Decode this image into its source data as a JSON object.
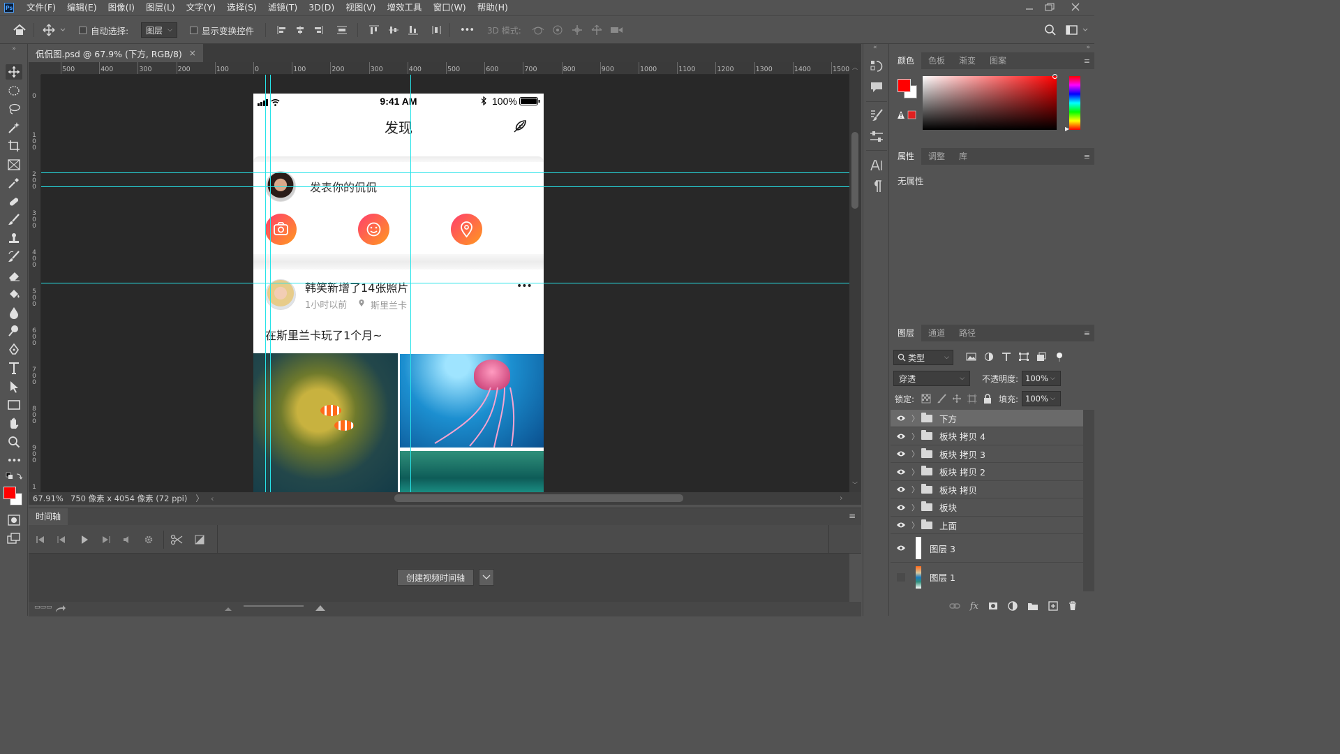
{
  "menubar": {
    "items": [
      "文件(F)",
      "编辑(E)",
      "图像(I)",
      "图层(L)",
      "文字(Y)",
      "选择(S)",
      "滤镜(T)",
      "3D(D)",
      "视图(V)",
      "增效工具",
      "窗口(W)",
      "帮助(H)"
    ]
  },
  "options": {
    "auto_select": "自动选择:",
    "layer_select": "图层",
    "show_transform": "显示变换控件",
    "more": "•••",
    "mode3d": "3D 模式:"
  },
  "document": {
    "tab_title": "侃侃图.psd @ 67.9% (下方, RGB/8)",
    "ruler_top": [
      "500",
      "400",
      "300",
      "200",
      "100",
      "0",
      "100",
      "200",
      "300",
      "400",
      "500",
      "600",
      "700",
      "800",
      "900",
      "1000",
      "1100",
      "1200",
      "1300",
      "1400",
      "1500"
    ],
    "ruler_left": [
      "0",
      "1\n0\n0",
      "2\n0\n0",
      "3\n0\n0",
      "4\n0\n0",
      "5\n0\n0",
      "6\n0\n0",
      "7\n0\n0",
      "8\n0\n0",
      "9\n0\n0",
      "1"
    ]
  },
  "status": {
    "zoom": "67.91%",
    "info": "750 像素 x 4054 像素 (72 ppi)",
    "arrow": "〉"
  },
  "artboard": {
    "time": "9:41 AM",
    "battery": "100%",
    "title": "发现",
    "compose_placeholder": "发表你的侃侃",
    "post_author_line": "韩笑新增了14张照片",
    "post_time": "1小时以前",
    "post_location": "斯里兰卡",
    "post_text": "在斯里兰卡玩了1个月~",
    "more_dots": "•••"
  },
  "timeline": {
    "title": "时间轴",
    "create_button": "创建视频时间轴"
  },
  "panels": {
    "color_tabs": [
      "颜色",
      "色板",
      "渐变",
      "图案"
    ],
    "props_tabs": [
      "属性",
      "调整",
      "库"
    ],
    "props_empty": "无属性",
    "layers_tabs": [
      "图层",
      "通道",
      "路径"
    ],
    "filter_type": "类型",
    "blend_mode": "穿透",
    "opacity_label": "不透明度:",
    "opacity_value": "100%",
    "lock_label": "锁定:",
    "fill_label": "填充:",
    "fill_value": "100%",
    "layers": [
      {
        "name": "下方",
        "kind": "group",
        "visible": true,
        "selected": true
      },
      {
        "name": "板块 拷贝 4",
        "kind": "group",
        "visible": true
      },
      {
        "name": "板块 拷贝 3",
        "kind": "group",
        "visible": true
      },
      {
        "name": "板块 拷贝 2",
        "kind": "group",
        "visible": true
      },
      {
        "name": "板块 拷贝",
        "kind": "group",
        "visible": true
      },
      {
        "name": "板块",
        "kind": "group",
        "visible": true
      },
      {
        "name": "上面",
        "kind": "group",
        "visible": true
      },
      {
        "name": "图层 3",
        "kind": "layer",
        "visible": true
      },
      {
        "name": "图层 1",
        "kind": "layer",
        "visible": false
      }
    ]
  },
  "colors": {
    "foreground": "#ff0000",
    "background": "#ffffff",
    "guide": "#27e3e8",
    "accent_gradient_start": "#ff3d6e",
    "accent_gradient_end": "#ff9a1f"
  }
}
